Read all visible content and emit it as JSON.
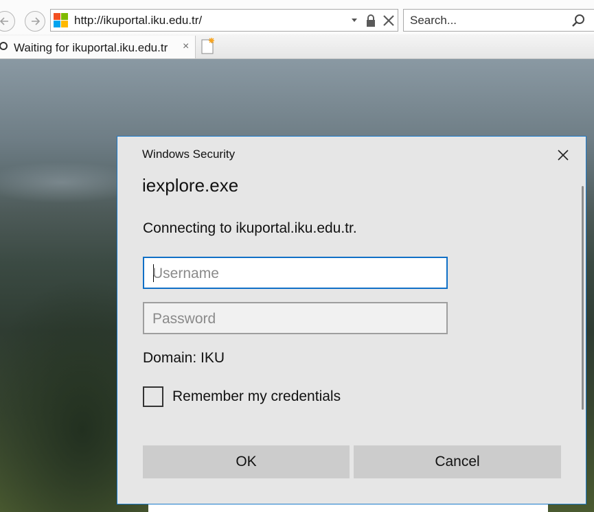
{
  "browser": {
    "address": {
      "url": "http://ikuportal.iku.edu.tr/"
    },
    "search": {
      "placeholder": "Search..."
    },
    "tab": {
      "title": "Waiting for ikuportal.iku.edu.tr",
      "close_glyph": "×"
    },
    "logo_colors": [
      "#f25022",
      "#7fba00",
      "#00a4ef",
      "#ffb900"
    ]
  },
  "dialog": {
    "caption": "Windows Security",
    "app_name": "iexplore.exe",
    "message": "Connecting to ikuportal.iku.edu.tr.",
    "username_placeholder": "Username",
    "password_placeholder": "Password",
    "domain": "Domain: IKU",
    "remember_label": "Remember my credentials",
    "remember_checked": false,
    "ok_label": "OK",
    "cancel_label": "Cancel",
    "accent_color": "#0f6fc6"
  }
}
